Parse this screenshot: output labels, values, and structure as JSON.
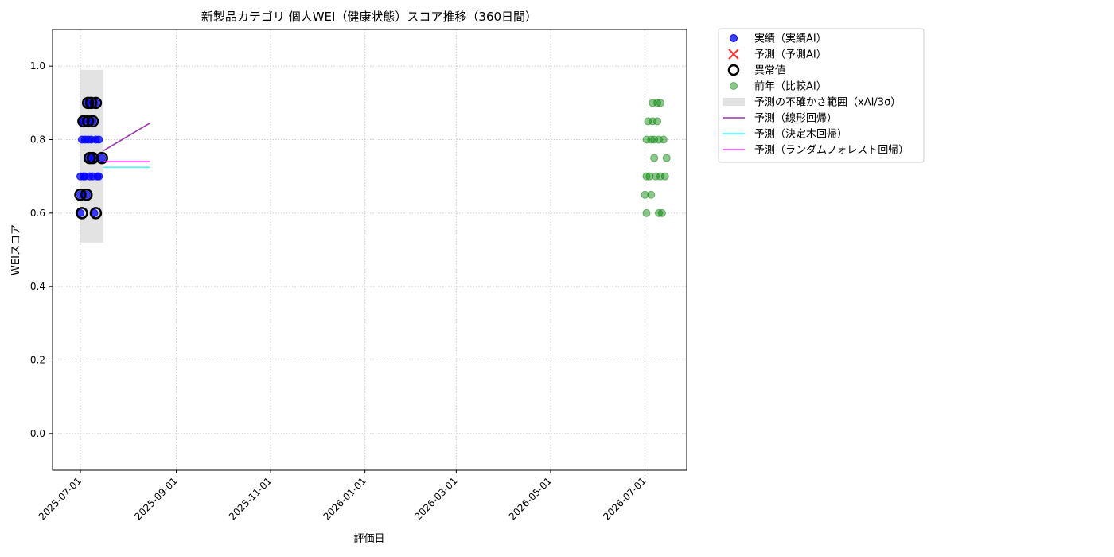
{
  "chart_data": {
    "type": "scatter",
    "title": "新製品カテゴリ 個人WEI（健康状態）スコア推移（360日間）",
    "xlabel": "評価日",
    "ylabel": "WEIスコア",
    "ylim": [
      -0.1,
      1.1
    ],
    "yticks": [
      "0.0",
      "0.2",
      "0.4",
      "0.6",
      "0.8",
      "1.0"
    ],
    "xlim": [
      "2025-06-13",
      "2026-07-35"
    ],
    "xticks": [
      "2025-07-01",
      "2025-09-01",
      "2025-11-01",
      "2026-01-01",
      "2026-03-01",
      "2026-05-01",
      "2026-07-01"
    ],
    "grid": true,
    "legend_position": "outside-top-right",
    "colors": {
      "actual": "#0000ff",
      "predicted": "#ff3333",
      "anomaly": "#000000",
      "prev_year": "#008000",
      "uncertainty": "#d9d9d9",
      "linear": "#9933aa",
      "tree": "#33ffff",
      "forest": "#ff33ff"
    },
    "legend": [
      {
        "key": "actual",
        "label": "実績（実績AI）",
        "marker": "dot"
      },
      {
        "key": "predicted",
        "label": "予測（予測AI）",
        "marker": "x"
      },
      {
        "key": "anomaly",
        "label": "異常値",
        "marker": "ring"
      },
      {
        "key": "prev_year",
        "label": "前年（比較AI）",
        "marker": "dot-faded"
      },
      {
        "key": "uncertainty",
        "label": "予測の不確かさ範囲（xAI/3σ）",
        "marker": "box"
      },
      {
        "key": "linear",
        "label": "予測（線形回帰）",
        "marker": "line"
      },
      {
        "key": "tree",
        "label": "予測（決定木回帰）",
        "marker": "line"
      },
      {
        "key": "forest",
        "label": "予測（ランダムフォレスト回帰）",
        "marker": "line"
      }
    ],
    "series": [
      {
        "key": "actual",
        "points": [
          {
            "x": "2025-07-01",
            "y": 0.65
          },
          {
            "x": "2025-07-01",
            "y": 0.6
          },
          {
            "x": "2025-07-01",
            "y": 0.7
          },
          {
            "x": "2025-07-02",
            "y": 0.8
          },
          {
            "x": "2025-07-02",
            "y": 0.85
          },
          {
            "x": "2025-07-03",
            "y": 0.7
          },
          {
            "x": "2025-07-03",
            "y": 0.85
          },
          {
            "x": "2025-07-04",
            "y": 0.8
          },
          {
            "x": "2025-07-04",
            "y": 0.7
          },
          {
            "x": "2025-07-05",
            "y": 0.65
          },
          {
            "x": "2025-07-05",
            "y": 0.9
          },
          {
            "x": "2025-07-06",
            "y": 0.75
          },
          {
            "x": "2025-07-06",
            "y": 0.8
          },
          {
            "x": "2025-07-07",
            "y": 0.85
          },
          {
            "x": "2025-07-07",
            "y": 0.9
          },
          {
            "x": "2025-07-07",
            "y": 0.7
          },
          {
            "x": "2025-07-08",
            "y": 0.75
          },
          {
            "x": "2025-07-08",
            "y": 0.8
          },
          {
            "x": "2025-07-09",
            "y": 0.85
          },
          {
            "x": "2025-07-09",
            "y": 0.7
          },
          {
            "x": "2025-07-10",
            "y": 0.6
          },
          {
            "x": "2025-07-10",
            "y": 0.75
          },
          {
            "x": "2025-07-11",
            "y": 0.8
          },
          {
            "x": "2025-07-11",
            "y": 0.9
          },
          {
            "x": "2025-07-12",
            "y": 0.7
          },
          {
            "x": "2025-07-13",
            "y": 0.8
          },
          {
            "x": "2025-07-13",
            "y": 0.7
          },
          {
            "x": "2025-07-15",
            "y": 0.75
          }
        ]
      },
      {
        "key": "anomaly",
        "points": [
          {
            "x": "2025-07-01",
            "y": 0.65
          },
          {
            "x": "2025-07-02",
            "y": 0.6
          },
          {
            "x": "2025-07-03",
            "y": 0.85
          },
          {
            "x": "2025-07-05",
            "y": 0.65
          },
          {
            "x": "2025-07-06",
            "y": 0.9
          },
          {
            "x": "2025-07-06",
            "y": 0.85
          },
          {
            "x": "2025-07-07",
            "y": 0.75
          },
          {
            "x": "2025-07-08",
            "y": 0.9
          },
          {
            "x": "2025-07-09",
            "y": 0.85
          },
          {
            "x": "2025-07-09",
            "y": 0.75
          },
          {
            "x": "2025-07-11",
            "y": 0.6
          },
          {
            "x": "2025-07-11",
            "y": 0.9
          },
          {
            "x": "2025-07-15",
            "y": 0.75
          }
        ]
      },
      {
        "key": "prev_year",
        "points": [
          {
            "x": "2026-07-01",
            "y": 0.65
          },
          {
            "x": "2026-07-02",
            "y": 0.6
          },
          {
            "x": "2026-07-02",
            "y": 0.7
          },
          {
            "x": "2026-07-02",
            "y": 0.8
          },
          {
            "x": "2026-07-03",
            "y": 0.85
          },
          {
            "x": "2026-07-04",
            "y": 0.7
          },
          {
            "x": "2026-07-05",
            "y": 0.8
          },
          {
            "x": "2026-07-05",
            "y": 0.65
          },
          {
            "x": "2026-07-06",
            "y": 0.85
          },
          {
            "x": "2026-07-06",
            "y": 0.9
          },
          {
            "x": "2026-07-07",
            "y": 0.75
          },
          {
            "x": "2026-07-07",
            "y": 0.8
          },
          {
            "x": "2026-07-08",
            "y": 0.7
          },
          {
            "x": "2026-07-09",
            "y": 0.9
          },
          {
            "x": "2026-07-09",
            "y": 0.85
          },
          {
            "x": "2026-07-10",
            "y": 0.8
          },
          {
            "x": "2026-07-10",
            "y": 0.6
          },
          {
            "x": "2026-07-11",
            "y": 0.7
          },
          {
            "x": "2026-07-11",
            "y": 0.9
          },
          {
            "x": "2026-07-12",
            "y": 0.6
          },
          {
            "x": "2026-07-13",
            "y": 0.8
          },
          {
            "x": "2026-07-14",
            "y": 0.7
          },
          {
            "x": "2026-07-15",
            "y": 0.75
          }
        ]
      }
    ],
    "uncertainty_band": {
      "x_start": "2025-07-01",
      "x_end": "2025-07-16",
      "y_low": 0.52,
      "y_high": 0.99
    },
    "prediction_lines": [
      {
        "key": "linear",
        "points": [
          {
            "x": "2025-07-16",
            "y": 0.77
          },
          {
            "x": "2025-08-15",
            "y": 0.845
          }
        ]
      },
      {
        "key": "tree",
        "points": [
          {
            "x": "2025-07-16",
            "y": 0.725
          },
          {
            "x": "2025-08-15",
            "y": 0.725
          }
        ]
      },
      {
        "key": "forest",
        "points": [
          {
            "x": "2025-07-16",
            "y": 0.74
          },
          {
            "x": "2025-08-15",
            "y": 0.74
          }
        ]
      }
    ]
  }
}
